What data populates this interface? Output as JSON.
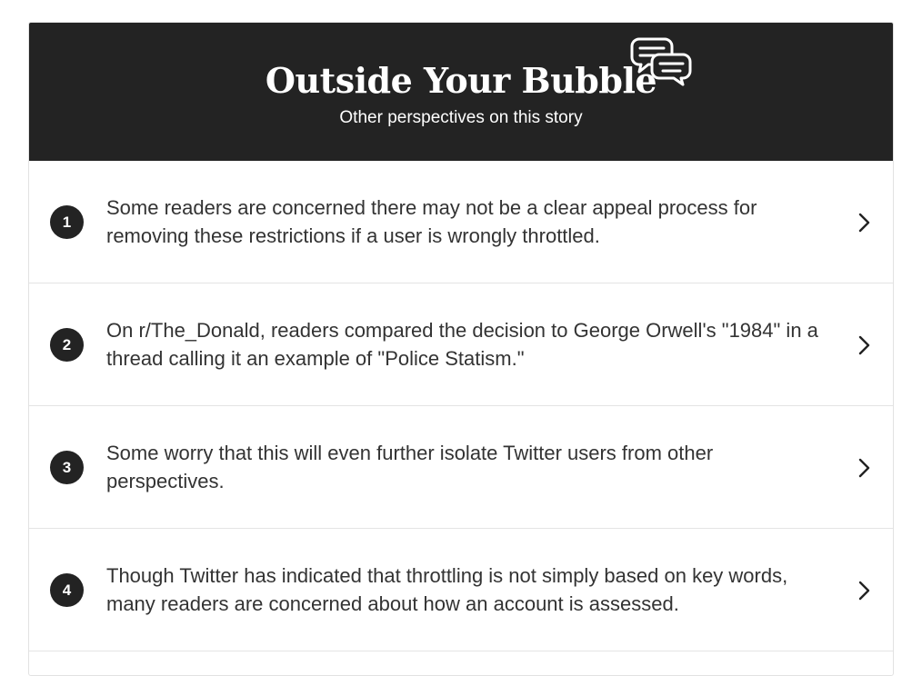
{
  "header": {
    "title": "Outside Your Bubble",
    "subtitle": "Other perspectives on this story",
    "icon": "speech-bubbles-icon",
    "background_color": "#232323"
  },
  "items": [
    {
      "number": "1",
      "text": "Some readers are concerned there may not be a clear appeal process for removing these restrictions if a user is wrongly throttled."
    },
    {
      "number": "2",
      "text": "On r/The_Donald, readers compared the decision to George Orwell's \"1984\" in a thread calling it an example of \"Police Statism.\""
    },
    {
      "number": "3",
      "text": "Some worry that this will even further isolate Twitter users from other perspectives."
    },
    {
      "number": "4",
      "text": "Though Twitter has indicated that throttling is not simply based on key words, many readers are concerned about how an account is assessed."
    }
  ]
}
